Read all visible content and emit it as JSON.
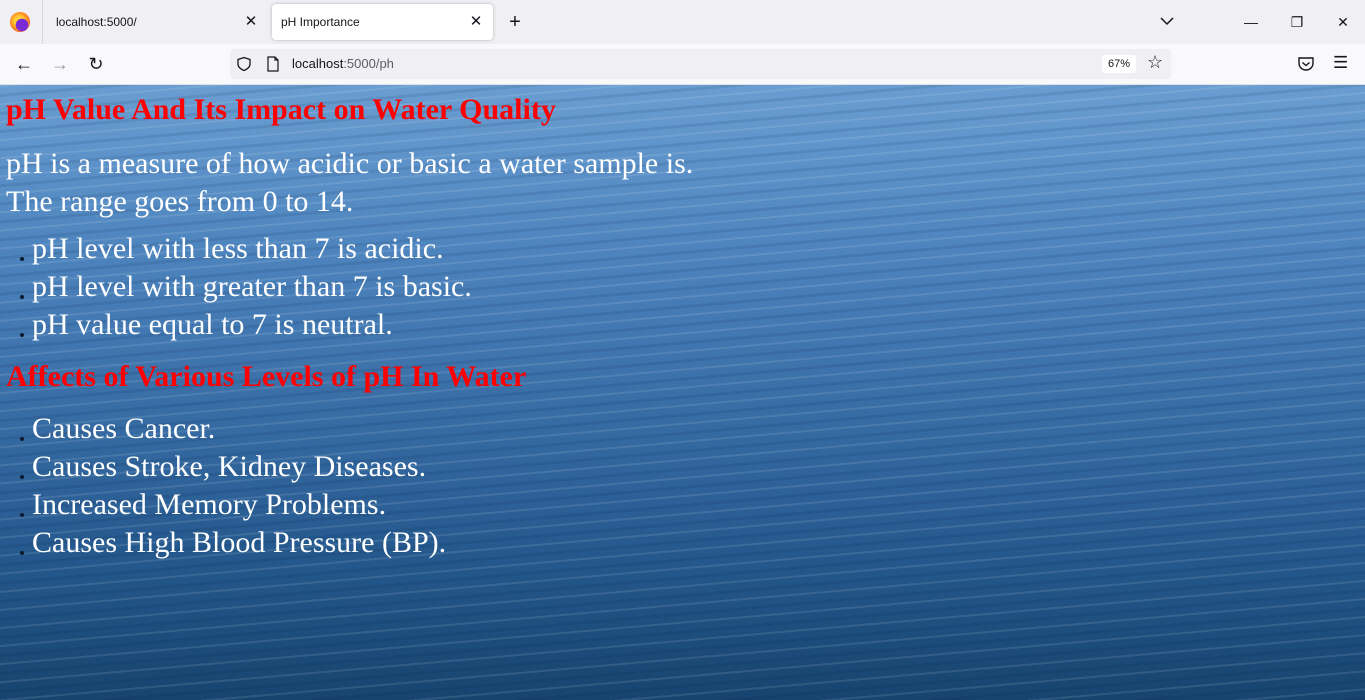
{
  "browser": {
    "tabs": [
      {
        "title": "localhost:5000/"
      },
      {
        "title": "pH Importance"
      }
    ],
    "url_host": "localhost",
    "url_path": ":5000/ph",
    "zoom": "67%"
  },
  "page": {
    "heading": "pH Value And Its Impact on Water Quality",
    "intro_line1": "pH is a measure of how acidic or basic a water sample is.",
    "intro_line2": "The range goes from 0 to 14.",
    "ph_levels": [
      "pH level with less than 7 is acidic.",
      "pH level with greater than 7 is basic.",
      "pH value equal to 7 is neutral."
    ],
    "effects_heading": "Affects of Various Levels of pH In Water",
    "effects": [
      "Causes Cancer.",
      "Causes Stroke, Kidney Diseases.",
      "Increased Memory Problems.",
      "Causes High Blood Pressure (BP)."
    ]
  }
}
